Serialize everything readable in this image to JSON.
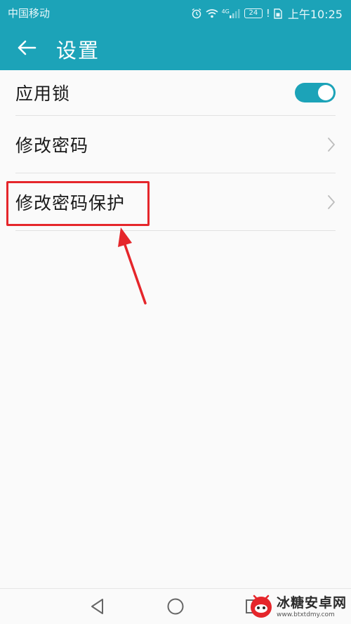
{
  "status_bar": {
    "carrier": "中国移动",
    "network": "4G",
    "battery": "24",
    "time": "上午10:25"
  },
  "header": {
    "title": "设置",
    "back_icon": "arrow-left-icon"
  },
  "settings": {
    "items": [
      {
        "label": "应用锁",
        "control": "toggle",
        "enabled": true
      },
      {
        "label": "修改密码",
        "control": "chevron"
      },
      {
        "label": "修改密码保护",
        "control": "chevron",
        "highlighted": true
      }
    ]
  },
  "navigation": {
    "back_icon": "triangle-back-icon",
    "home_icon": "circle-home-icon",
    "recents_icon": "square-recents-icon"
  },
  "watermark": {
    "title": "冰糖安卓网",
    "url": "www.btxtdmy.com"
  },
  "colors": {
    "primary": "#1ca3b8",
    "annotation": "#e5262b",
    "background": "#fafafa"
  }
}
